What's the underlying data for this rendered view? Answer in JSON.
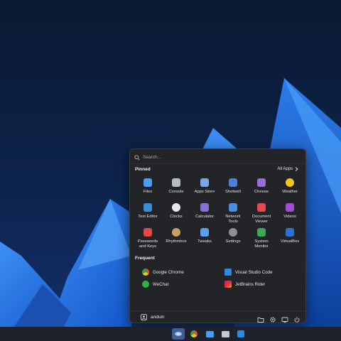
{
  "desktop": {
    "wallpaper": "blue-geometric-mountains"
  },
  "start_menu": {
    "search_placeholder": "Search...",
    "pinned_title": "Pinned",
    "all_apps_label": "All Apps",
    "pinned": [
      {
        "label": "Files",
        "icon": "files-icon",
        "color": "#4a9df0"
      },
      {
        "label": "Console",
        "icon": "console-icon",
        "color": "#b8bcc4"
      },
      {
        "label": "Apps Store",
        "icon": "apps-store-icon",
        "color": "#7aa6e8"
      },
      {
        "label": "Shotwell",
        "icon": "shotwell-icon",
        "color": "#4b7fd6"
      },
      {
        "label": "Cheese",
        "icon": "cheese-icon",
        "color": "#9b6bd6"
      },
      {
        "label": "Weather",
        "icon": "weather-icon",
        "color": "#f5c518"
      },
      {
        "label": "Text Editor",
        "icon": "text-editor-icon",
        "color": "#3a8fd8"
      },
      {
        "label": "Clocks",
        "icon": "clocks-icon",
        "color": "#e8e8ec"
      },
      {
        "label": "Calculator",
        "icon": "calculator-icon",
        "color": "#8a6fd0"
      },
      {
        "label": "Network\nTools",
        "icon": "network-tools-icon",
        "color": "#4a8fe0"
      },
      {
        "label": "Document\nViewer",
        "icon": "document-viewer-icon",
        "color": "#e8484f"
      },
      {
        "label": "Videos",
        "icon": "videos-icon",
        "color": "#a14bd6"
      },
      {
        "label": "Passwords\nand Keys",
        "icon": "passwords-icon",
        "color": "#e04848"
      },
      {
        "label": "Rhythmbox",
        "icon": "rhythmbox-icon",
        "color": "#c8a060"
      },
      {
        "label": "Tweaks",
        "icon": "tweaks-icon",
        "color": "#5aa0e8"
      },
      {
        "label": "Settings",
        "icon": "settings-icon",
        "color": "#8d8f94"
      },
      {
        "label": "System\nMonitor",
        "icon": "system-monitor-icon",
        "color": "#3aa858"
      },
      {
        "label": "VirtualBox",
        "icon": "virtualbox-icon",
        "color": "#2f6fd6"
      }
    ],
    "frequent_title": "Frequent",
    "frequent": [
      {
        "label": "Google Chrome",
        "icon": "chrome-icon"
      },
      {
        "label": "Visual Studio Code",
        "icon": "vscode-icon"
      },
      {
        "label": "WeChat",
        "icon": "wechat-icon"
      },
      {
        "label": "JetBrains Rider",
        "icon": "rider-icon"
      }
    ],
    "user_name": "anduin"
  },
  "taskbar": {
    "items": [
      "start-icon",
      "chrome-icon",
      "files-icon",
      "console-icon",
      "vscode-icon"
    ]
  }
}
